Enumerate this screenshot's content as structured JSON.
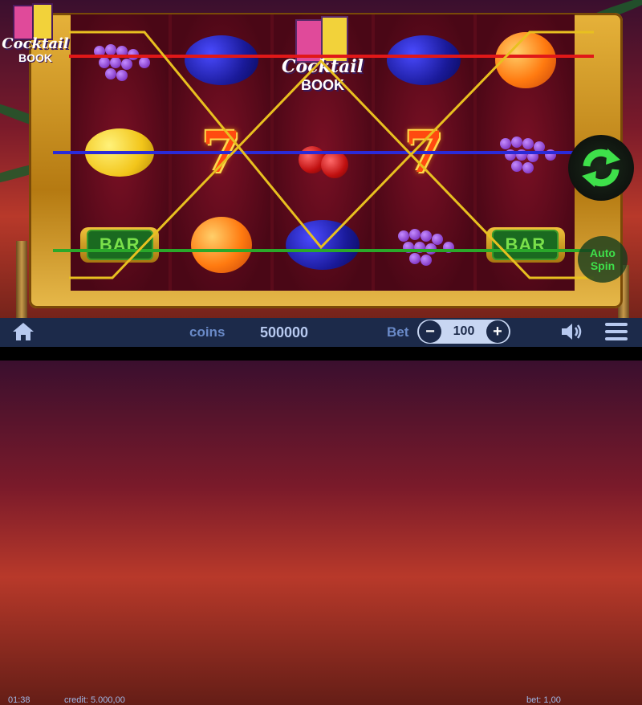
{
  "logo": {
    "line1": "Cocktail",
    "line2": "BOOK"
  },
  "reels": [
    [
      "grapes",
      "plum",
      "orange"
    ],
    [
      "lemon",
      "seven",
      "bar"
    ],
    [
      "book",
      "cherries",
      "plum"
    ],
    [
      "plum",
      "seven",
      "grapes"
    ],
    [
      "orange",
      "grapes",
      "bar"
    ]
  ],
  "book_symbol": {
    "line1": "Cocktail",
    "line2": "BOOK"
  },
  "bar_label": "BAR",
  "buttons": {
    "auto_line1": "Auto",
    "auto_line2": "Spin",
    "minus": "−",
    "plus": "+"
  },
  "bottom_bar": {
    "coins_label": "coins",
    "coins_value": "500000",
    "bet_label": "Bet",
    "bet_value": "100"
  },
  "info_bar": {
    "time": "01:38",
    "credit": "credit: 5.000,00",
    "bet": "bet: 1,00"
  },
  "colors": {
    "line_red": "#e01818",
    "line_blue": "#2a2ad8",
    "line_green": "#2aa82a",
    "line_yellow": "#e8c020",
    "spin_green": "#3ee04a"
  }
}
